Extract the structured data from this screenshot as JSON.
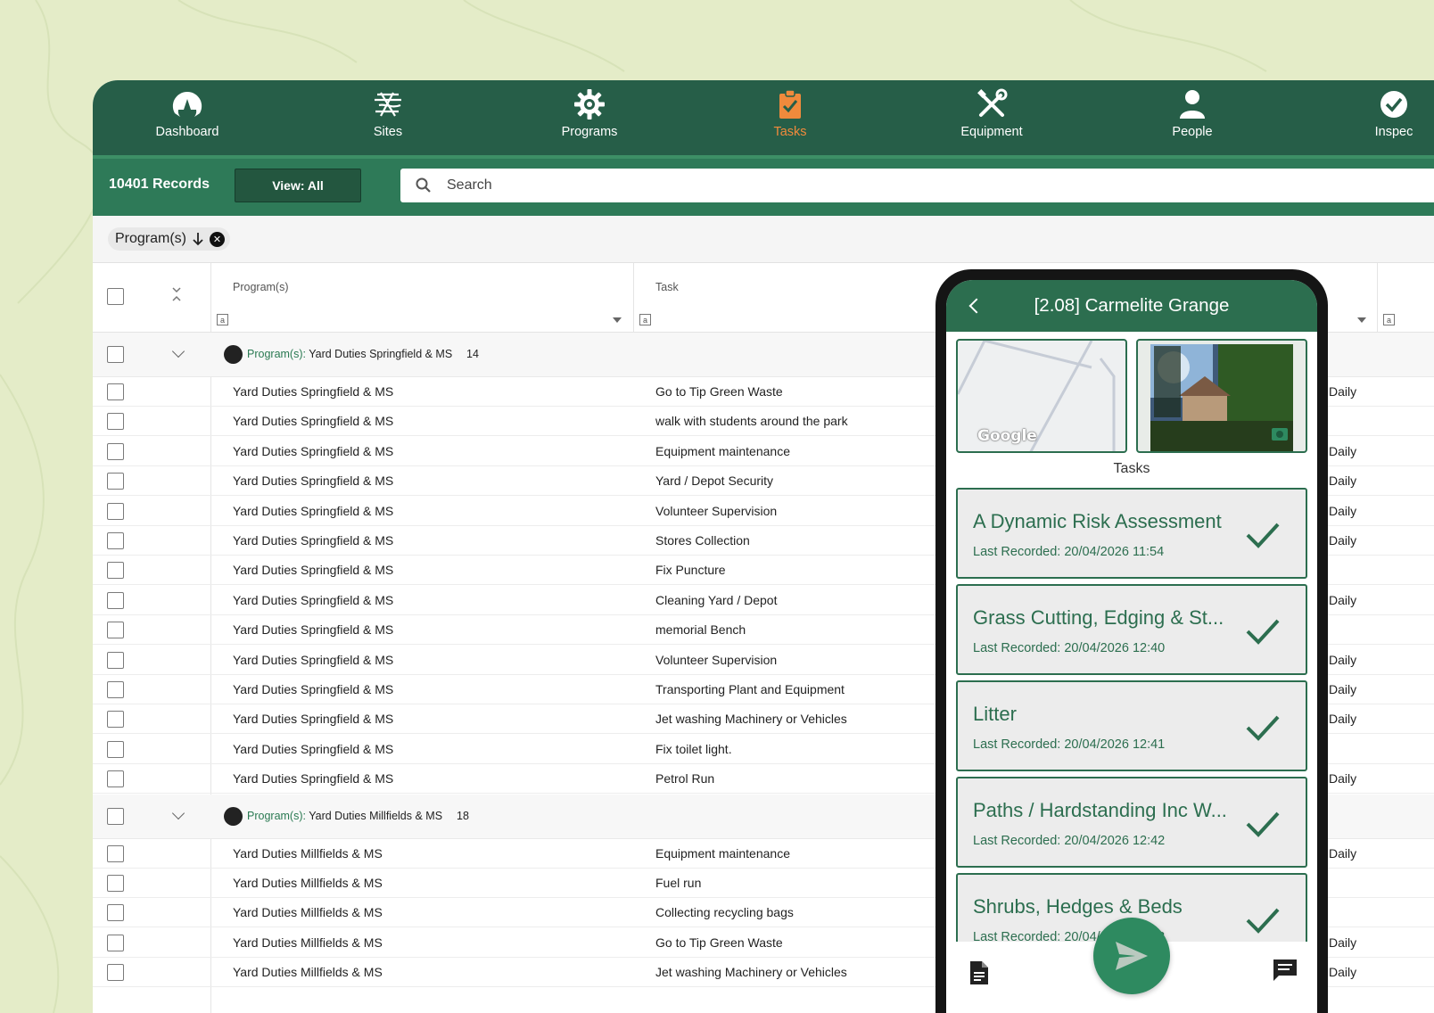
{
  "nav": {
    "items": [
      {
        "label": "Dashboard",
        "icon": "dashboard-icon",
        "active": false
      },
      {
        "label": "Sites",
        "icon": "sites-icon",
        "active": false
      },
      {
        "label": "Programs",
        "icon": "gear-icon",
        "active": false
      },
      {
        "label": "Tasks",
        "icon": "clipboard-check-icon",
        "active": true
      },
      {
        "label": "Equipment",
        "icon": "tools-icon",
        "active": false
      },
      {
        "label": "People",
        "icon": "person-icon",
        "active": false
      },
      {
        "label": "Inspec",
        "icon": "check-circle-icon",
        "active": false
      }
    ],
    "accent_color": "#f08a3c",
    "bg_color": "#265e48"
  },
  "toolbar": {
    "records": "10401 Records",
    "view_label": "View: All",
    "search_placeholder": "Search"
  },
  "filter_chip": {
    "label": "Program(s)",
    "sort_icon": "arrow-down-icon"
  },
  "table": {
    "headers": {
      "program": "Program(s)",
      "task": "Task"
    },
    "filter_box_glyph": "a",
    "groups": [
      {
        "key": "Program(s):",
        "name": "Yard Duties Springfield & MS",
        "count": "14",
        "rows": [
          {
            "program": "Yard Duties Springfield & MS",
            "task": "Go to Tip Green Waste",
            "freq": "Daily"
          },
          {
            "program": "Yard Duties Springfield & MS",
            "task": "walk with students around the park",
            "freq": ""
          },
          {
            "program": "Yard Duties Springfield & MS",
            "task": "Equipment maintenance",
            "freq": "Daily"
          },
          {
            "program": "Yard Duties Springfield & MS",
            "task": "Yard / Depot Security",
            "freq": "Daily"
          },
          {
            "program": "Yard Duties Springfield & MS",
            "task": "Volunteer Supervision",
            "freq": "Daily"
          },
          {
            "program": "Yard Duties Springfield & MS",
            "task": "Stores Collection",
            "freq": "Daily"
          },
          {
            "program": "Yard Duties Springfield & MS",
            "task": "Fix Puncture",
            "freq": ""
          },
          {
            "program": "Yard Duties Springfield & MS",
            "task": "Cleaning Yard / Depot",
            "freq": "Daily"
          },
          {
            "program": "Yard Duties Springfield & MS",
            "task": "memorial Bench",
            "freq": ""
          },
          {
            "program": "Yard Duties Springfield & MS",
            "task": "Volunteer Supervision",
            "freq": "Daily"
          },
          {
            "program": "Yard Duties Springfield & MS",
            "task": "Transporting Plant and Equipment",
            "freq": "Daily"
          },
          {
            "program": "Yard Duties Springfield & MS",
            "task": "Jet washing Machinery or Vehicles",
            "freq": "Daily"
          },
          {
            "program": "Yard Duties Springfield & MS",
            "task": "Fix toilet light.",
            "freq": ""
          },
          {
            "program": "Yard Duties Springfield & MS",
            "task": "Petrol Run",
            "freq": "Daily"
          }
        ]
      },
      {
        "key": "Program(s):",
        "name": "Yard Duties Millfields & MS",
        "count": "18",
        "rows": [
          {
            "program": "Yard Duties Millfields & MS",
            "task": "Equipment maintenance",
            "freq": "Daily"
          },
          {
            "program": "Yard Duties Millfields & MS",
            "task": "Fuel run",
            "freq": ""
          },
          {
            "program": "Yard Duties Millfields & MS",
            "task": "Collecting recycling bags",
            "freq": ""
          },
          {
            "program": "Yard Duties Millfields & MS",
            "task": "Go to Tip Green Waste",
            "freq": "Daily"
          },
          {
            "program": "Yard Duties Millfields & MS",
            "task": "Jet washing Machinery or Vehicles",
            "freq": "Daily"
          }
        ]
      }
    ]
  },
  "phone": {
    "title": "[2.08] Carmelite Grange",
    "map_logo": "Google",
    "tasks_label": "Tasks",
    "tasks": [
      {
        "name": "A Dynamic Risk Assessment",
        "recorded": "Last Recorded: 20/04/2026 11:54"
      },
      {
        "name": "Grass Cutting, Edging & St...",
        "recorded": "Last Recorded: 20/04/2026 12:40"
      },
      {
        "name": "Litter",
        "recorded": "Last Recorded: 20/04/2026 12:41"
      },
      {
        "name": "Paths / Hardstanding Inc W...",
        "recorded": "Last Recorded: 20/04/2026 12:42"
      },
      {
        "name": "Shrubs, Hedges & Beds",
        "recorded": "Last Recorded: 20/04/2026 12:43"
      }
    ],
    "brand_color": "#2c6e4f"
  }
}
